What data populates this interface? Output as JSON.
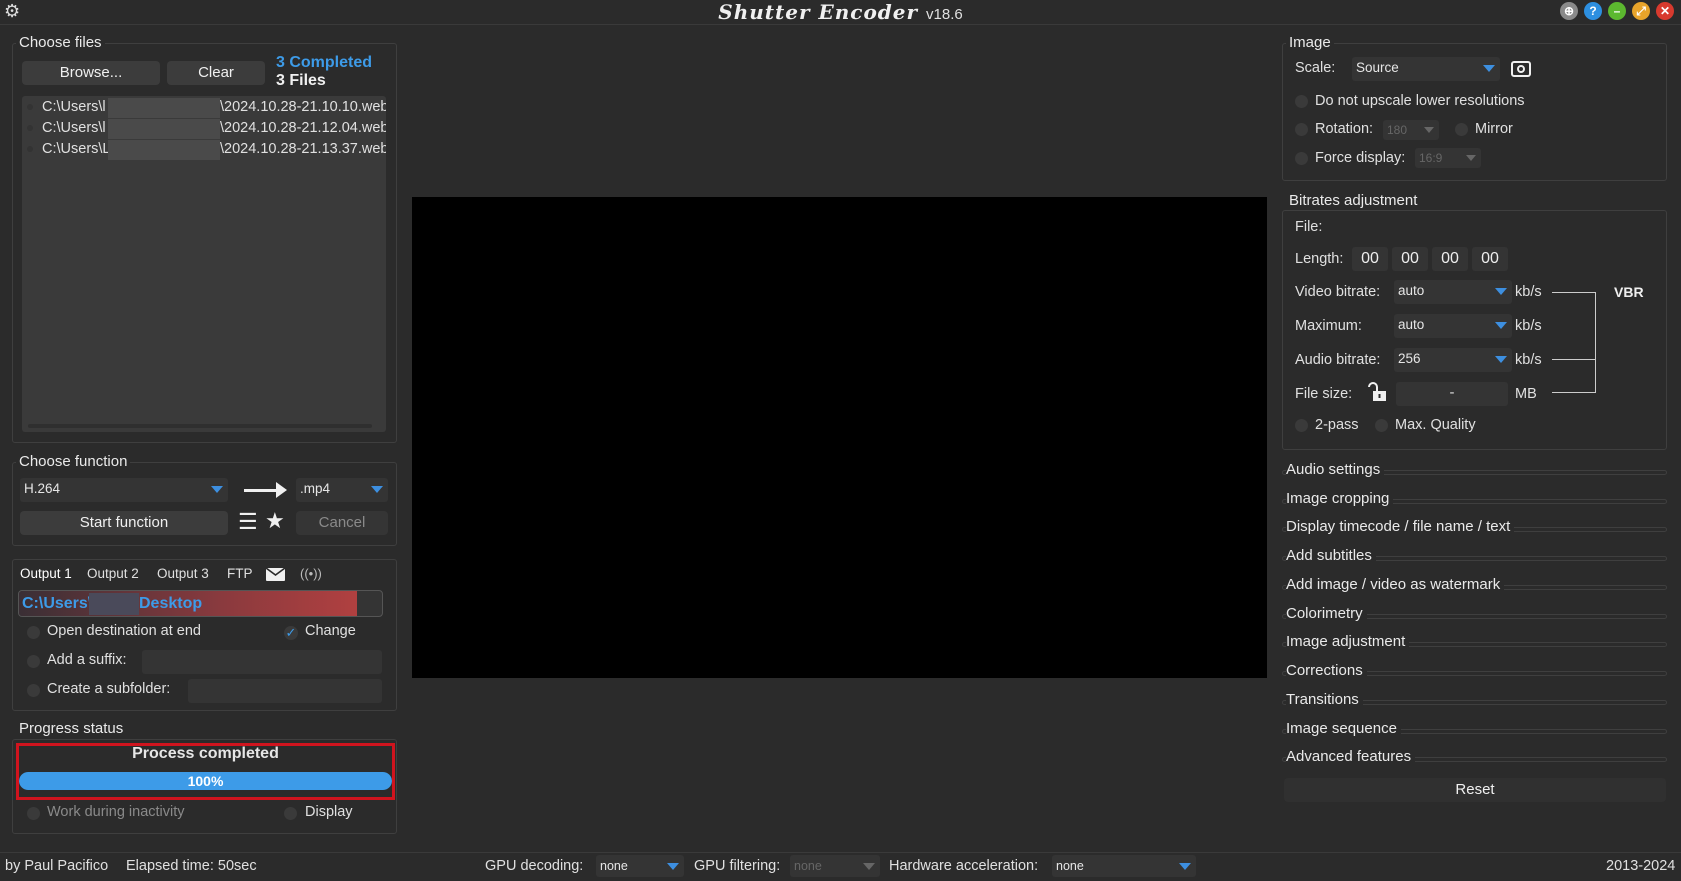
{
  "app": {
    "name": "Shutter Encoder",
    "version": "v18.6"
  },
  "files": {
    "legend": "Choose files",
    "browse_label": "Browse...",
    "clear_label": "Clear",
    "completed": "3 Completed",
    "count": "3 Files",
    "items": [
      {
        "prefix": "C:\\Users\\l",
        "suffix": "\\2024.10.28-21.10.10.web"
      },
      {
        "prefix": "C:\\Users\\l",
        "suffix": "\\2024.10.28-21.12.04.web"
      },
      {
        "prefix": "C:\\Users\\L",
        "suffix": "\\2024.10.28-21.13.37.web"
      }
    ]
  },
  "function": {
    "legend": "Choose function",
    "selected": "H.264",
    "extension": ".mp4",
    "start_label": "Start function",
    "cancel_label": "Cancel"
  },
  "output": {
    "tabs": [
      "Output 1",
      "Output 2",
      "Output 3",
      "FTP"
    ],
    "path_prefix": "C:\\Users\\",
    "path_suffix": "Desktop",
    "open_destination": "Open destination at end",
    "change_label": "Change",
    "suffix_label": "Add a suffix:",
    "subfolder_label": "Create a subfolder:"
  },
  "progress": {
    "legend": "Progress status",
    "status": "Process completed",
    "percent_text": "100%",
    "value": 1.0,
    "inactivity_label": "Work during inactivity",
    "display_label": "Display"
  },
  "image": {
    "legend": "Image",
    "scale_label": "Scale:",
    "scale_value": "Source",
    "no_upscale": "Do not upscale lower resolutions",
    "rotation_label": "Rotation:",
    "rotation_value": "180",
    "mirror_label": "Mirror",
    "force_label": "Force display:",
    "force_value": "16:9"
  },
  "bitrates": {
    "legend": "Bitrates adjustment",
    "file_label": "File:",
    "length_label": "Length:",
    "length": [
      "00",
      "00",
      "00",
      "00"
    ],
    "video_label": "Video bitrate:",
    "video_value": "auto",
    "max_label": "Maximum:",
    "max_value": "auto",
    "audio_label": "Audio bitrate:",
    "audio_value": "256",
    "unit": "kb/s",
    "vbr": "VBR",
    "size_label": "File size:",
    "size_value": "-",
    "size_unit": "MB",
    "twopass": "2-pass",
    "maxquality": "Max. Quality"
  },
  "sections": [
    "Audio settings",
    "Image cropping",
    "Display timecode / file name / text",
    "Add subtitles",
    "Add image / video as watermark",
    "Colorimetry",
    "Image adjustment",
    "Corrections",
    "Transitions",
    "Image sequence",
    "Advanced features"
  ],
  "reset_label": "Reset",
  "status": {
    "author": "by Paul Pacifico",
    "elapsed": "Elapsed time: 50sec",
    "gpu_decoding_label": "GPU decoding:",
    "gpu_decoding_value": "none",
    "gpu_filtering_label": "GPU filtering:",
    "gpu_filtering_value": "none",
    "hw_label": "Hardware acceleration:",
    "hw_value": "none",
    "years": "2013-2024"
  },
  "colors": {
    "accent": "#3d8fe0",
    "highlight": "#d0141e",
    "progress": "#3d9be8"
  }
}
